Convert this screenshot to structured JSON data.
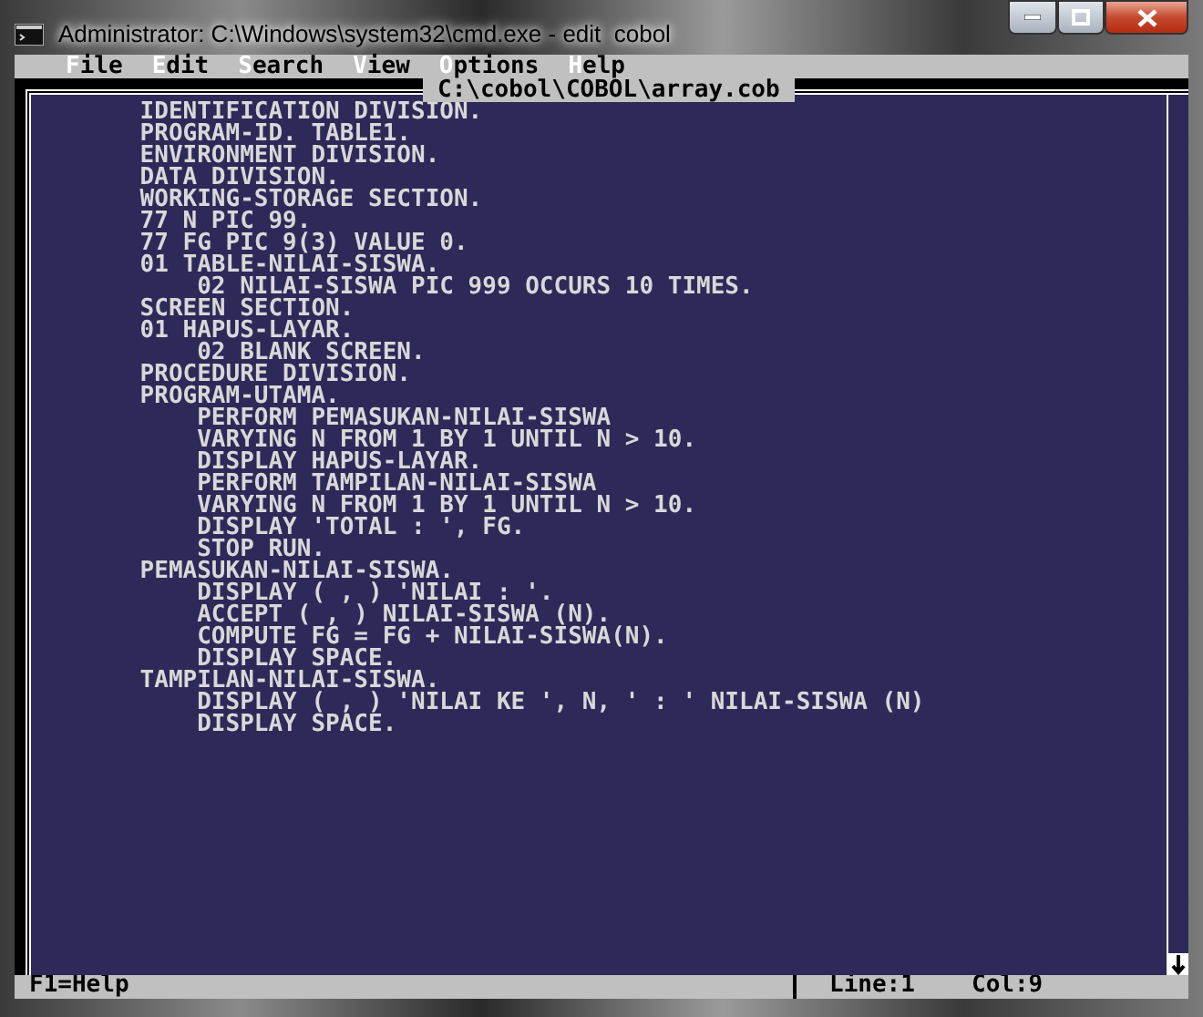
{
  "window": {
    "title": "Administrator: C:\\Windows\\system32\\cmd.exe - edit  cobol"
  },
  "menu": [
    {
      "label": "File"
    },
    {
      "label": "Edit"
    },
    {
      "label": "Search"
    },
    {
      "label": "View"
    },
    {
      "label": "Options"
    },
    {
      "label": "Help"
    }
  ],
  "editor": {
    "filename": "C:\\cobol\\COBOL\\array.cob",
    "lines": [
      "       IDENTIFICATION DIVISION.",
      "       PROGRAM-ID. TABLE1.",
      "       ENVIRONMENT DIVISION.",
      "       DATA DIVISION.",
      "       WORKING-STORAGE SECTION.",
      "       77 N PIC 99.",
      "       77 FG PIC 9(3) VALUE 0.",
      "       01 TABLE-NILAI-SISWA.",
      "           02 NILAI-SISWA PIC 999 OCCURS 10 TIMES.",
      "       SCREEN SECTION.",
      "       01 HAPUS-LAYAR.",
      "           02 BLANK SCREEN.",
      "       PROCEDURE DIVISION.",
      "       PROGRAM-UTAMA.",
      "           PERFORM PEMASUKAN-NILAI-SISWA",
      "           VARYING N FROM 1 BY 1 UNTIL N > 10.",
      "           DISPLAY HAPUS-LAYAR.",
      "           PERFORM TAMPILAN-NILAI-SISWA",
      "           VARYING N FROM 1 BY 1 UNTIL N > 10.",
      "           DISPLAY 'TOTAL : ', FG.",
      "           STOP RUN.",
      "       PEMASUKAN-NILAI-SISWA.",
      "           DISPLAY ( , ) 'NILAI : '.",
      "           ACCEPT ( , ) NILAI-SISWA (N).",
      "           COMPUTE FG = FG + NILAI-SISWA(N).",
      "           DISPLAY SPACE.",
      "       TAMPILAN-NILAI-SISWA.",
      "           DISPLAY ( , ) 'NILAI KE ', N, ' : ' NILAI-SISWA (N)",
      "           DISPLAY SPACE."
    ]
  },
  "status_bar": {
    "help": "F1=Help",
    "line": "Line:1",
    "col": "Col:9"
  }
}
